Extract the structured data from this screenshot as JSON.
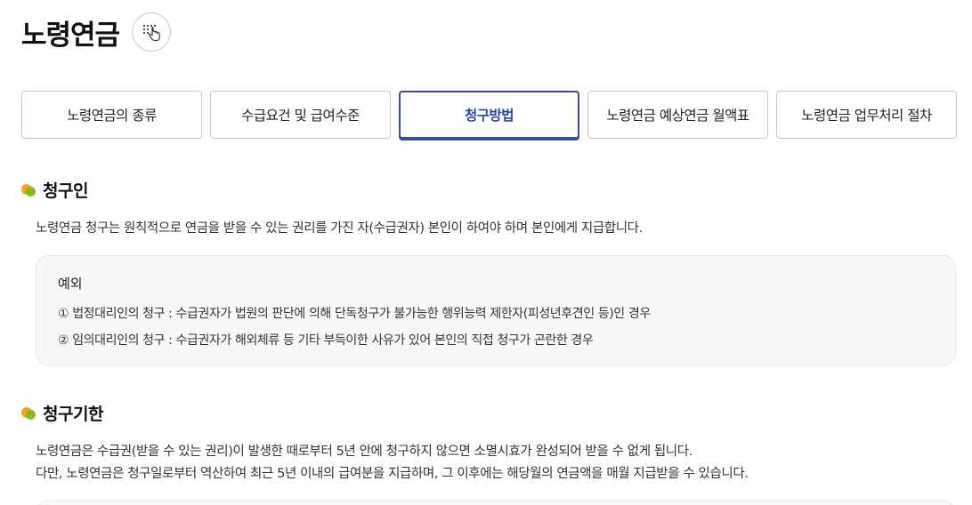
{
  "page": {
    "title": "노령연금",
    "icon": "accessibility-hand-icon"
  },
  "tabs": [
    {
      "label": "노령연금의 종류",
      "active": false
    },
    {
      "label": "수급요건 및 급여수준",
      "active": false
    },
    {
      "label": "청구방법",
      "active": true
    },
    {
      "label": "노령연금 예상연금 월액표",
      "active": false
    },
    {
      "label": "노령연금 업무처리 절차",
      "active": false
    }
  ],
  "sections": {
    "claimant": {
      "title": "청구인",
      "text": "노령연금 청구는 원칙적으로 연금을 받을 수 있는 권리를 가진 자(수급권자) 본인이 하여야 하며 본인에게 지급합니다.",
      "exception": {
        "title": "예외",
        "items": [
          "① 법정대리인의 청구 : 수급권자가 법원의 판단에 의해 단독청구가 불가능한 행위능력 제한자(피성년후견인 등)인 경우",
          "② 임의대리인의 청구 : 수급권자가 해외체류 등 기타 부득이한 사유가 있어 본인의 직접 청구가 곤란한 경우"
        ]
      }
    },
    "deadline": {
      "title": "청구기한",
      "lines": [
        "노령연금은 수급권(받을 수 있는 권리)이 발생한 때로부터 5년 안에 청구하지 않으면 소멸시효가 완성되어 받을 수 없게 됩니다.",
        "다만, 노령연금은 청구일로부터 역산하여 최근 5년 이내의 급여분을 지급하며, 그 이후에는 해당월의 연금액을 매월 지급받을 수 있습니다."
      ]
    }
  },
  "colors": {
    "accent": "#3a4ba0",
    "bullet_orange": "#f0a61e",
    "bullet_green": "#7ab829"
  }
}
